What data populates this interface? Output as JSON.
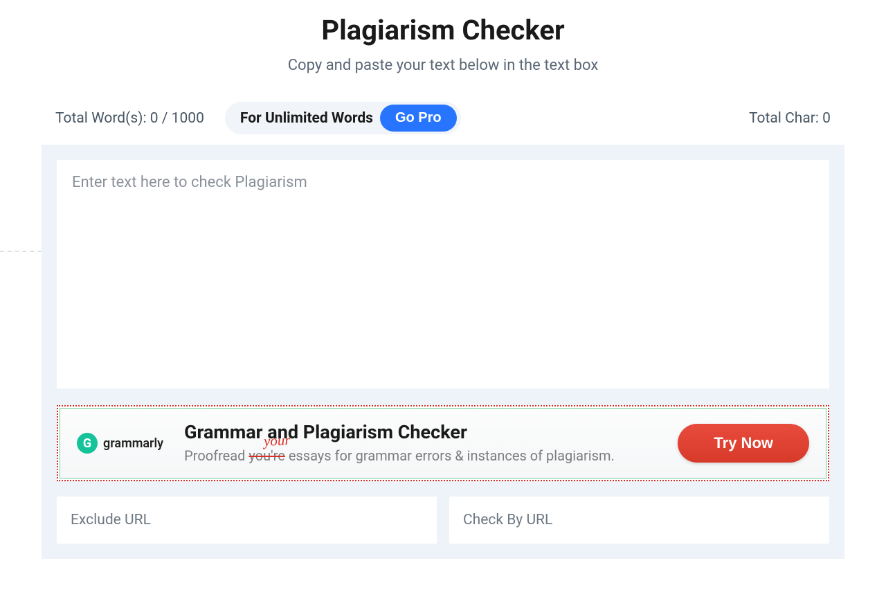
{
  "header": {
    "title": "Plagiarism Checker",
    "subtitle": "Copy and paste your text below in the text box"
  },
  "stats": {
    "word_count_label": "Total Word(s): 0 / 1000",
    "unlimited_label": "For Unlimited Words",
    "go_pro_label": "Go Pro",
    "char_count_label": "Total Char: 0"
  },
  "textarea": {
    "placeholder": "Enter text here to check Plagiarism"
  },
  "ad": {
    "brand_name": "grammarly",
    "brand_icon_letter": "G",
    "title": "Grammar and Plagiarism Checker",
    "handwritten": "your",
    "desc_prefix": "Proofread ",
    "desc_strike": "you're",
    "desc_suffix": " essays for grammar errors & instances of plagiarism.",
    "cta_label": "Try Now"
  },
  "url_inputs": {
    "exclude_placeholder": "Exclude URL",
    "check_placeholder": "Check By URL"
  }
}
